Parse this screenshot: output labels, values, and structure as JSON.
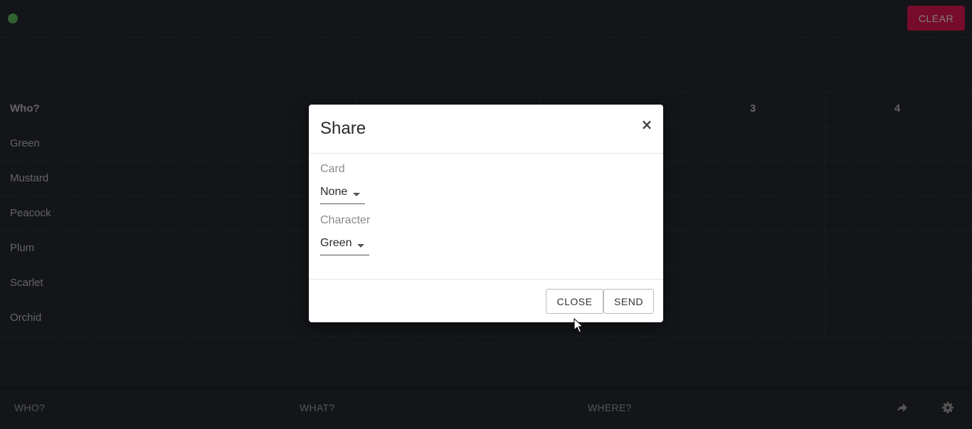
{
  "topbar": {
    "clear_label": "CLEAR",
    "status_color": "#62c462"
  },
  "grid": {
    "header": {
      "who_label": "Who?",
      "columns": [
        "3",
        "4"
      ]
    },
    "rows": [
      "Green",
      "Mustard",
      "Peacock",
      "Plum",
      "Scarlet",
      "Orchid"
    ]
  },
  "bottombar": {
    "tabs": [
      "WHO?",
      "WHAT?",
      "WHERE?"
    ],
    "icons": [
      "share-icon",
      "gear-icon"
    ]
  },
  "modal": {
    "title": "Share",
    "close_symbol": "×",
    "card": {
      "label": "Card",
      "value": "None"
    },
    "character": {
      "label": "Character",
      "value": "Green"
    },
    "buttons": {
      "close": "CLOSE",
      "send": "SEND"
    }
  }
}
